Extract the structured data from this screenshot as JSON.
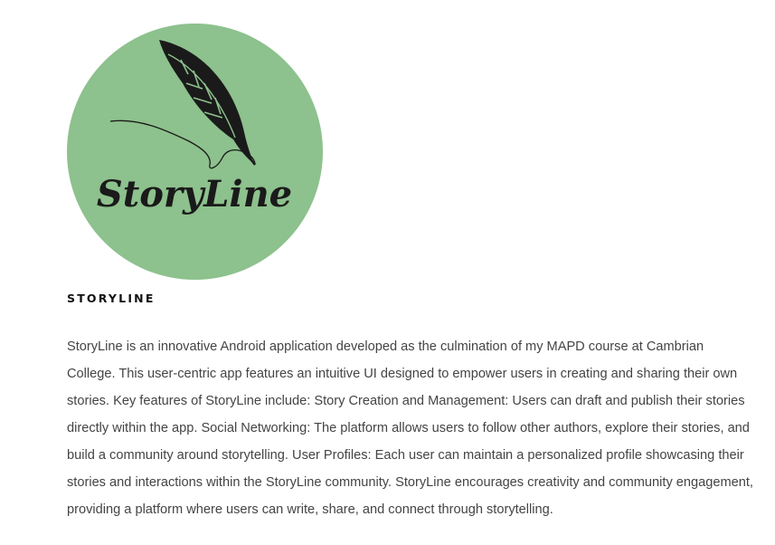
{
  "logo": {
    "wordmark": "StoryLine",
    "background_color": "#8dc18d",
    "ink_color": "#1a1a1a",
    "icon": "feather-quill-icon"
  },
  "project": {
    "title": "STORYLINE",
    "description": "StoryLine is an innovative Android application developed as the culmination of my MAPD course at Cambrian College. This user-centric app features an intuitive UI designed to empower users in creating and sharing their own stories. Key features of StoryLine include: Story Creation and Management: Users can draft and publish their stories directly within the app. Social Networking: The platform allows users to follow other authors, explore their stories, and build a community around storytelling. User Profiles: Each user can maintain a personalized profile showcasing their stories and interactions within the StoryLine community. StoryLine encourages creativity and community engagement, providing a platform where users can write, share, and connect through storytelling."
  }
}
